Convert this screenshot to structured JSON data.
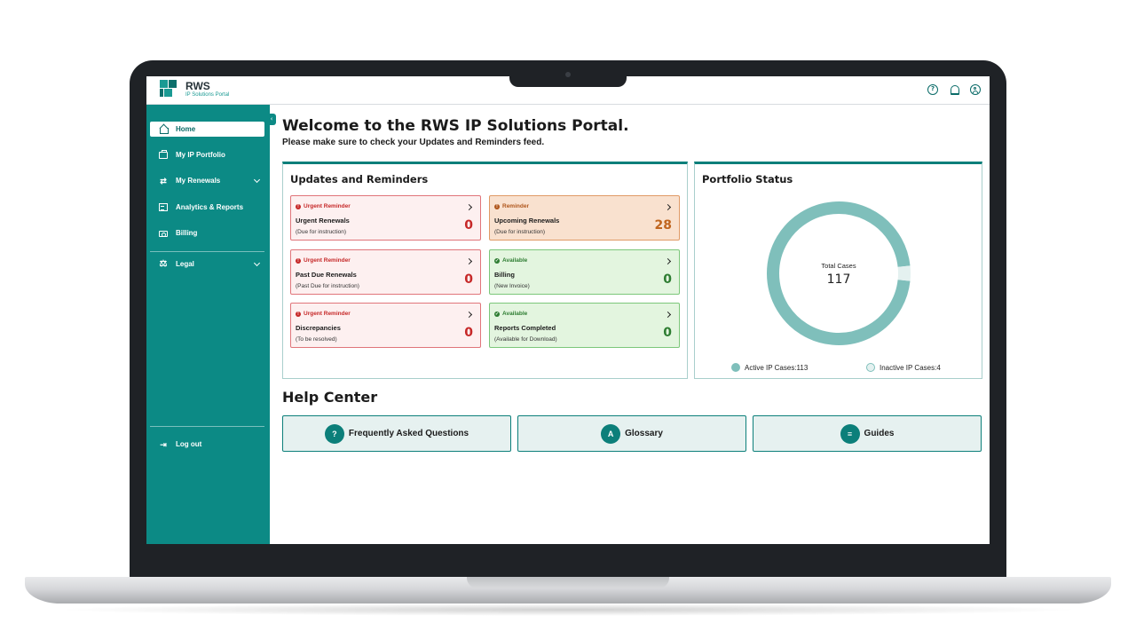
{
  "brand": {
    "name": "RWS",
    "subtitle": "IP Solutions Portal",
    "accent": "#0c8a85"
  },
  "topbar": {
    "icons": [
      "help-icon",
      "bell-icon",
      "user-icon"
    ],
    "help_glyph": "?"
  },
  "sidebar": {
    "items": [
      {
        "label": "Home",
        "icon": "home-icon",
        "active": true
      },
      {
        "label": "My IP Portfolio",
        "icon": "portfolio-icon"
      },
      {
        "label": "My Renewals",
        "icon": "renewals-icon",
        "expandable": true
      },
      {
        "label": "Analytics & Reports",
        "icon": "analytics-icon"
      },
      {
        "label": "Billing",
        "icon": "billing-icon"
      },
      {
        "label": "Legal",
        "icon": "legal-icon",
        "expandable": true
      }
    ],
    "logout": "Log out"
  },
  "main": {
    "title": "Welcome to the RWS IP Solutions Portal.",
    "subtitle": "Please make sure to check your Updates and Reminders feed."
  },
  "updates": {
    "title": "Updates and Reminders",
    "tiles": [
      {
        "status": "Urgent Reminder",
        "name": "Urgent Renewals",
        "note": "(Due for instruction)",
        "count": "0",
        "tone": "red"
      },
      {
        "status": "Reminder",
        "name": "Upcoming Renewals",
        "note": "(Due for instruction)",
        "count": "28",
        "tone": "orange"
      },
      {
        "status": "Urgent Reminder",
        "name": "Past Due Renewals",
        "note": "(Past Due for instruction)",
        "count": "0",
        "tone": "red"
      },
      {
        "status": "Available",
        "name": "Billing",
        "note": "(New Invoice)",
        "count": "0",
        "tone": "green"
      },
      {
        "status": "Urgent Reminder",
        "name": "Discrepancies",
        "note": "(To be resolved)",
        "count": "0",
        "tone": "red"
      },
      {
        "status": "Available",
        "name": "Reports Completed",
        "note": "(Available for Download)",
        "count": "0",
        "tone": "green"
      }
    ]
  },
  "portfolio": {
    "title": "Portfolio Status",
    "total_label": "Total Cases",
    "total_value": "117",
    "legend": [
      {
        "label": "Active IP Cases:113",
        "color": "#7fbfbb"
      },
      {
        "label": "Inactive IP Cases:4",
        "color": "#e4f1f0"
      }
    ]
  },
  "chart_data": {
    "type": "pie",
    "categories": [
      "Active IP Cases",
      "Inactive IP Cases"
    ],
    "values": [
      113,
      4
    ],
    "title": "Portfolio Status",
    "colors": [
      "#7fbfbb",
      "#e4f1f0"
    ]
  },
  "help": {
    "title": "Help Center",
    "buttons": [
      {
        "label": "Frequently Asked Questions",
        "icon": "faq-icon",
        "glyph": "?"
      },
      {
        "label": "Glossary",
        "icon": "glossary-icon",
        "glyph": "A"
      },
      {
        "label": "Guides",
        "icon": "guides-icon",
        "glyph": "≡"
      }
    ]
  },
  "status_glyphs": {
    "alert": "!",
    "check": "✓"
  }
}
